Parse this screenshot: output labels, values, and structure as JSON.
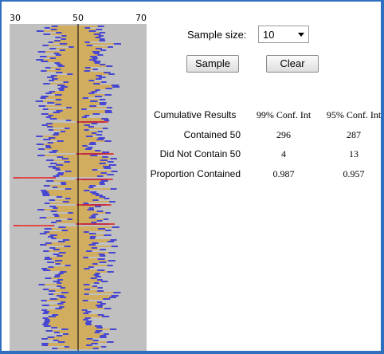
{
  "axis": {
    "min": 30,
    "mid": 50,
    "max": 70,
    "labels": [
      "30",
      "50",
      "70"
    ]
  },
  "controls": {
    "sample_size_label": "Sample size:",
    "sample_size_value": "10",
    "sample_button": "Sample",
    "clear_button": "Clear"
  },
  "results": {
    "title": "Cumulative Results",
    "col99": "99% Conf. Int",
    "col95": "95% Conf. Int",
    "rows": [
      {
        "label": "Contained 50",
        "v99": "296",
        "v95": "287"
      },
      {
        "label": "Did Not Contain 50",
        "v99": "4",
        "v95": "13"
      },
      {
        "label": "Proportion Contained",
        "v99": "0.987",
        "v95": "0.957"
      }
    ]
  },
  "colors": {
    "panel": "#c0c0c0",
    "contained99": "#f2c23c",
    "contained95": "#1f1fd8",
    "miss95": "#e01818",
    "miss99": "#ffffff",
    "centerline": "#000000",
    "frame": "#2f6fbf"
  }
}
